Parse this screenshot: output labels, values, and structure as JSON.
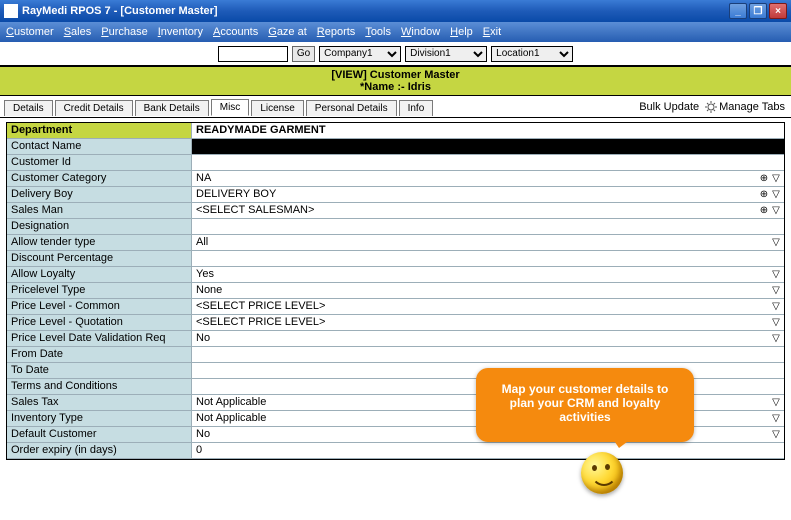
{
  "window": {
    "title": "RayMedi RPOS 7 - [Customer Master]"
  },
  "menu": {
    "items": [
      "Customer",
      "Sales",
      "Purchase",
      "Inventory",
      "Accounts",
      "Gaze at",
      "Reports",
      "Tools",
      "Window",
      "Help",
      "Exit"
    ]
  },
  "toolbar": {
    "search_value": "",
    "go_label": "Go",
    "company": "Company1",
    "division": "Division1",
    "location": "Location1"
  },
  "view_header": {
    "line1": "[VIEW]   Customer Master",
    "line2": "*Name :-  Idris"
  },
  "tabs": {
    "items": [
      {
        "label": "Details"
      },
      {
        "label": "Credit Details"
      },
      {
        "label": "Bank Details"
      },
      {
        "label": "Misc",
        "active": true
      },
      {
        "label": "License"
      },
      {
        "label": "Personal Details"
      },
      {
        "label": "Info"
      }
    ],
    "bulk_update_label": "Bulk Update",
    "manage_tabs_label": "Manage Tabs"
  },
  "grid": {
    "header_label": "Department",
    "header_value": "READYMADE GARMENT",
    "rows": [
      {
        "label": "Contact Name",
        "value": "",
        "contact": true
      },
      {
        "label": "Customer Id",
        "value": ""
      },
      {
        "label": "Customer Category",
        "value": "NA",
        "icons": [
          "plus",
          "down"
        ]
      },
      {
        "label": "Delivery Boy",
        "value": "DELIVERY BOY",
        "icons": [
          "plus",
          "down"
        ]
      },
      {
        "label": "Sales Man",
        "value": "<SELECT SALESMAN>",
        "icons": [
          "plus",
          "down"
        ]
      },
      {
        "label": "Designation",
        "value": ""
      },
      {
        "label": "Allow tender type",
        "value": "All",
        "icons": [
          "down"
        ]
      },
      {
        "label": "Discount Percentage",
        "value": ""
      },
      {
        "label": "Allow Loyalty",
        "value": "Yes",
        "icons": [
          "down"
        ]
      },
      {
        "label": "Pricelevel Type",
        "value": "None",
        "icons": [
          "down"
        ]
      },
      {
        "label": "Price Level - Common",
        "value": "<SELECT PRICE LEVEL>",
        "icons": [
          "down"
        ]
      },
      {
        "label": "Price Level - Quotation",
        "value": "<SELECT PRICE LEVEL>",
        "icons": [
          "down"
        ]
      },
      {
        "label": "Price Level Date Validation Req",
        "value": "No",
        "icons": [
          "down"
        ]
      },
      {
        "label": "From Date",
        "value": ""
      },
      {
        "label": "To Date",
        "value": ""
      },
      {
        "label": "Terms and Conditions",
        "value": ""
      },
      {
        "label": "Sales Tax",
        "value": "Not Applicable",
        "icons": [
          "down"
        ]
      },
      {
        "label": "Inventory Type",
        "value": "Not Applicable",
        "icons": [
          "down"
        ]
      },
      {
        "label": "Default Customer",
        "value": "No",
        "icons": [
          "down"
        ]
      },
      {
        "label": "Order expiry (in days)",
        "value": "0"
      }
    ]
  },
  "callout": {
    "text": "Map your customer details to plan your CRM and loyalty activities"
  }
}
